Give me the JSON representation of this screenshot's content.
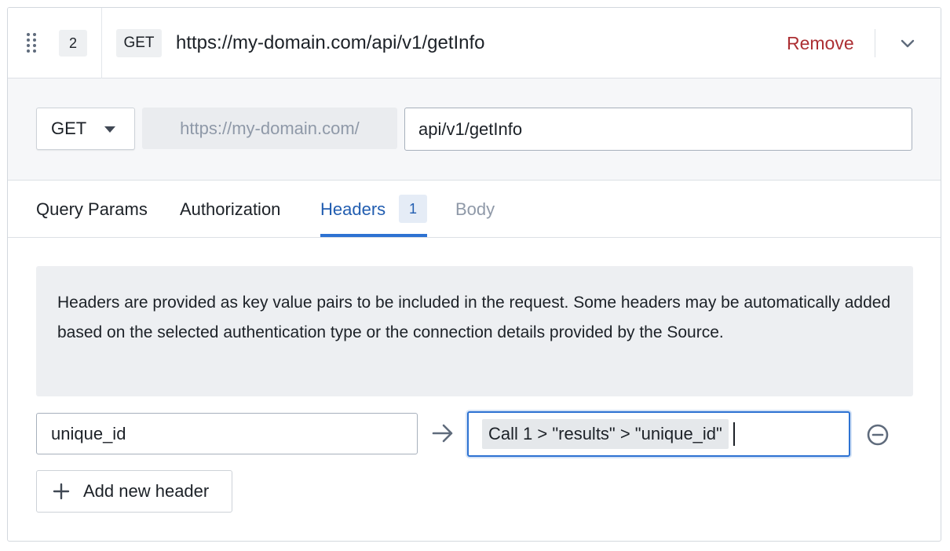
{
  "step": {
    "index": "2",
    "method_tag": "GET",
    "url": "https://my-domain.com/api/v1/getInfo",
    "remove_label": "Remove"
  },
  "request": {
    "method": "GET",
    "base_url": "https://my-domain.com/",
    "path": "api/v1/getInfo"
  },
  "tabs": [
    {
      "label": "Query Params"
    },
    {
      "label": "Authorization"
    },
    {
      "label": "Headers",
      "badge": "1",
      "active": true
    },
    {
      "label": "Body",
      "disabled": true
    }
  ],
  "headers_panel": {
    "description": "Headers are provided as key value pairs to be included in the request. Some headers may be automatically added based on the selected authentication type or the connection details provided by the Source.",
    "rows": [
      {
        "key": "unique_id",
        "value": "Call 1 > \"results\" > \"unique_id\""
      }
    ],
    "add_label": "Add new header"
  },
  "colors": {
    "accent": "#2d72d2",
    "danger": "#ac2f33",
    "active_tab": "#215db0",
    "muted": "#8f99a8"
  },
  "icons": [
    "drag-handle-icon",
    "chevron-down-icon",
    "caret-down-icon",
    "arrow-right-icon",
    "remove-circle-icon",
    "plus-icon"
  ]
}
